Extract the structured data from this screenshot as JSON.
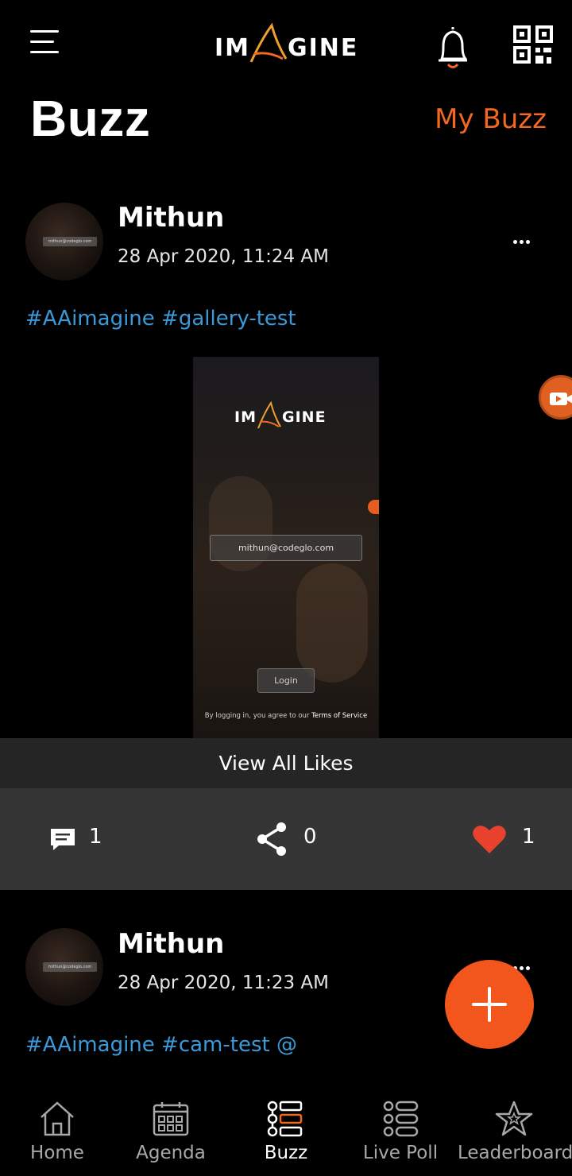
{
  "header": {
    "logo_text": "IMAGINE",
    "icons": [
      "menu-icon",
      "bell-icon",
      "qr-code-icon"
    ]
  },
  "page": {
    "title": "Buzz",
    "my_buzz_label": "My Buzz"
  },
  "posts": [
    {
      "author": "Mithun",
      "timestamp": "28 Apr 2020, 11:24 AM",
      "hashtags": "#AAimagine #gallery-test",
      "avatar_email": "mithun@codeglo.com",
      "image": {
        "logo_text": "IMAGINE",
        "email": "mithun@codeglo.com",
        "login_label": "Login",
        "terms_prefix": "By logging in, you agree to our",
        "terms_link": "Terms of Service"
      },
      "view_all_likes_label": "View All Likes",
      "comments_count": "1",
      "shares_count": "0",
      "likes_count": "1"
    },
    {
      "author": "Mithun",
      "timestamp": "28 Apr 2020, 11:23 AM",
      "hashtags": "#AAimagine #cam-test @",
      "avatar_email": "mithun@codeglo.com"
    }
  ],
  "bottom_nav": {
    "items": [
      {
        "label": "Home",
        "icon": "home-icon",
        "active": false
      },
      {
        "label": "Agenda",
        "icon": "calendar-icon",
        "active": false
      },
      {
        "label": "Buzz",
        "icon": "buzz-icon",
        "active": true
      },
      {
        "label": "Live Poll",
        "icon": "poll-icon",
        "active": false
      },
      {
        "label": "Leaderboard",
        "icon": "star-icon",
        "active": false
      }
    ]
  },
  "colors": {
    "accent": "#f26722",
    "hashtag": "#3b9ad9",
    "like": "#e8422f",
    "background": "#000000"
  }
}
